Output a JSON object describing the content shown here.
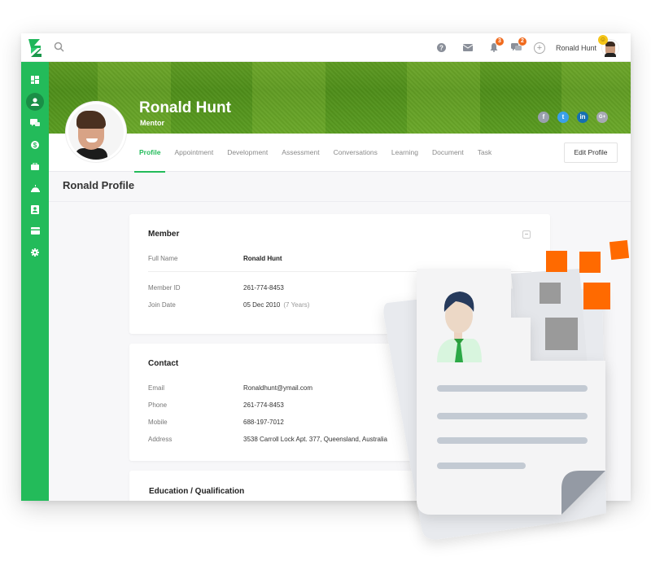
{
  "topbar": {
    "search_placeholder": "Search",
    "help_icon": "question-circle-icon",
    "mail_icon": "envelope-icon",
    "notifications": {
      "icon": "bell-icon",
      "count": "3"
    },
    "messages": {
      "icon": "chat-bubbles-icon",
      "count": "2"
    },
    "add_icon": "plus-circle-icon",
    "user_name": "Ronald Hunt",
    "status_emoji": "☺"
  },
  "sidebar": {
    "items": [
      {
        "name": "dashboard",
        "icon": "dashboard-grid-icon",
        "active": false
      },
      {
        "name": "profile",
        "icon": "user-icon",
        "active": true
      },
      {
        "name": "messages",
        "icon": "chat-icon",
        "active": false
      },
      {
        "name": "billing",
        "icon": "dollar-coin-icon",
        "active": false
      },
      {
        "name": "jobs",
        "icon": "briefcase-icon",
        "active": false
      },
      {
        "name": "services",
        "icon": "bell-dome-icon",
        "active": false
      },
      {
        "name": "contacts",
        "icon": "id-card-icon",
        "active": false
      },
      {
        "name": "payments",
        "icon": "credit-card-icon",
        "active": false
      },
      {
        "name": "settings",
        "icon": "gear-icon",
        "active": false
      }
    ]
  },
  "profile": {
    "name": "Ronald Hunt",
    "role": "Mentor",
    "social": [
      {
        "network": "facebook",
        "glyph": "f",
        "color": "#9aa0ad"
      },
      {
        "network": "twitter",
        "glyph": "t",
        "color": "#3aa0e8"
      },
      {
        "network": "linkedin",
        "glyph": "in",
        "color": "#1670b0"
      },
      {
        "network": "google-plus",
        "glyph": "G+",
        "color": "#a7a9b3"
      }
    ]
  },
  "tabs": [
    "Profile",
    "Appointment",
    "Development",
    "Assessment",
    "Conversations",
    "Learning",
    "Document",
    "Task"
  ],
  "active_tab": "Profile",
  "edit_profile_label": "Edit Profile",
  "page_title": "Ronald Profile",
  "member": {
    "title": "Member",
    "collapse_glyph": "−",
    "full_name_label": "Full Name",
    "full_name": "Ronald Hunt",
    "member_id_label": "Member ID",
    "member_id": "261-774-8453",
    "join_date_label": "Join Date",
    "join_date": "05 Dec 2010",
    "join_duration": "(7 Years)"
  },
  "contact": {
    "title": "Contact",
    "rows": [
      {
        "label": "Email",
        "value": "Ronaldhunt@ymail.com"
      },
      {
        "label": "Phone",
        "value": "261-774-8453"
      },
      {
        "label": "Mobile",
        "value": "688-197-7012"
      },
      {
        "label": "Address",
        "value": "3538 Carroll Lock Apt. 377, Queensland, Australia"
      }
    ]
  },
  "education": {
    "title": "Education / Qualification"
  },
  "colors": {
    "brand_green": "#23bb5a",
    "badge_orange": "#f06a1d",
    "accent_orange": "#ff6a00"
  }
}
